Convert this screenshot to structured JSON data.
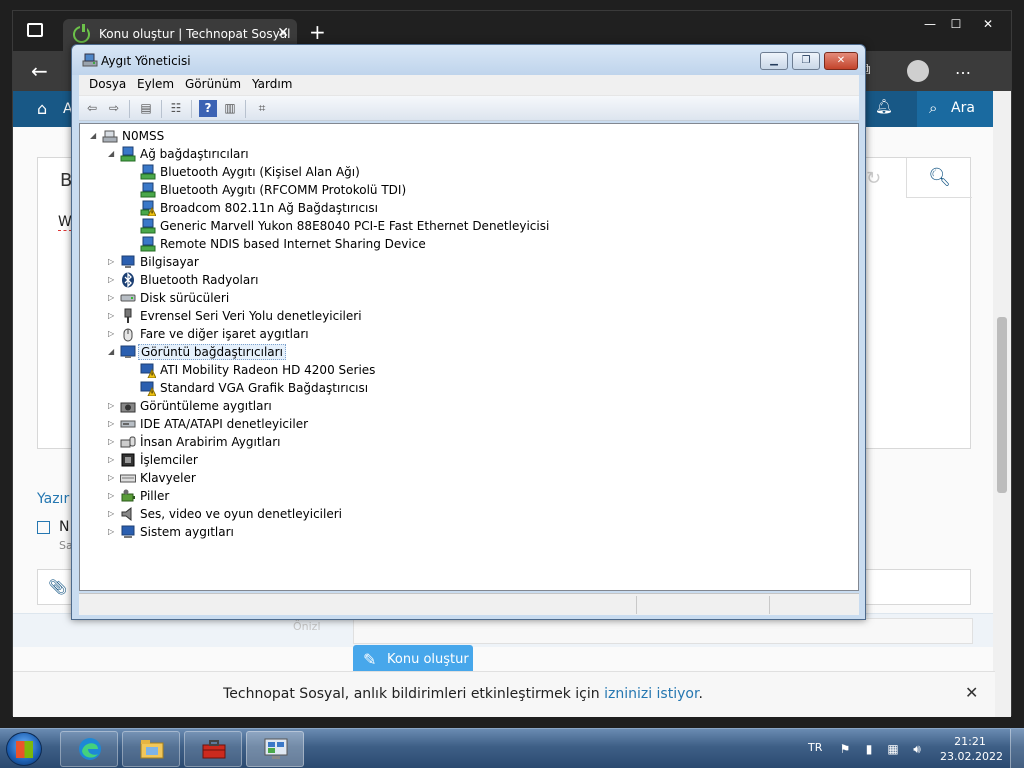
{
  "browser": {
    "tab_title": "Konu oluştur | Technopat Sosyal",
    "tab_close": "✕",
    "new_tab": "+",
    "window_minimize": "—",
    "window_maximize": "☐",
    "window_close": "✕",
    "back": "←",
    "more": "…"
  },
  "site": {
    "nav_partial": "A",
    "search_label": "Ara",
    "editor_partial_b": "B",
    "editor_partial_w": "W",
    "yazi_partial": "Yazır",
    "yazi_n": "N",
    "yazi_sa": "Sa",
    "faint_text": "Önizl",
    "submit_label": "Konu oluştur",
    "notification_prefix": "Technopat Sosyal, anlık bildirimleri etkinleştirmek için ",
    "notification_link": "izninizi istiyor",
    "notification_suffix": ".",
    "notification_close": "✕"
  },
  "devmgr": {
    "title": "Aygıt Yöneticisi",
    "menu": [
      "Dosya",
      "Eylem",
      "Görünüm",
      "Yardım"
    ],
    "tree": {
      "root": "N0MSS",
      "network_category": "Ağ bağdaştırıcıları",
      "network_items": [
        "Bluetooth Aygıtı (Kişisel Alan Ağı)",
        "Bluetooth Aygıtı (RFCOMM Protokolü TDI)",
        "Broadcom 802.11n Ağ Bağdaştırıcısı",
        "Generic Marvell Yukon 88E8040 PCI-E Fast Ethernet Denetleyicisi",
        "Remote NDIS based Internet Sharing Device"
      ],
      "cat_computer": "Bilgisayar",
      "cat_bluetooth": "Bluetooth Radyoları",
      "cat_disk": "Disk sürücüleri",
      "cat_usb": "Evrensel Seri Veri Yolu denetleyicileri",
      "cat_mouse": "Fare ve diğer işaret aygıtları",
      "display_category": "Görüntü bağdaştırıcıları",
      "display_items": [
        "ATI Mobility Radeon HD 4200 Series",
        "Standard VGA Grafik Bağdaştırıcısı"
      ],
      "cat_imaging": "Görüntüleme aygıtları",
      "cat_ide": "IDE ATA/ATAPI denetleyiciler",
      "cat_hid": "İnsan Arabirim Aygıtları",
      "cat_cpu": "İşlemciler",
      "cat_keyboard": "Klavyeler",
      "cat_battery": "Piller",
      "cat_sound": "Ses, video ve oyun denetleyicileri",
      "cat_system": "Sistem aygıtları"
    }
  },
  "taskbar": {
    "lang": "TR",
    "time": "21:21",
    "date": "23.02.2022"
  },
  "colors": {
    "site_nav": "#185886",
    "accent_blue": "#2577b1",
    "button_blue": "#47a7eb",
    "warning_yellow": "#f2c511"
  }
}
